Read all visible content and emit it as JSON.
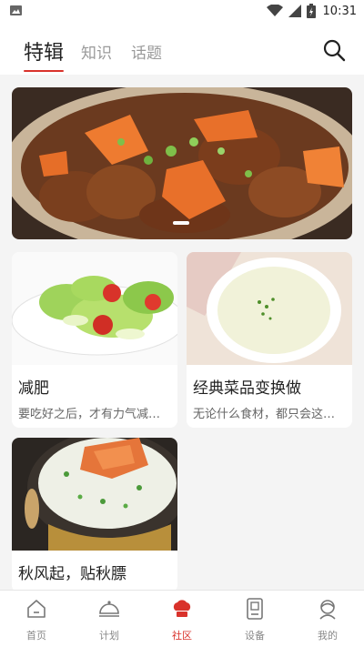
{
  "status_bar": {
    "time": "10:31",
    "icons": [
      "image-notification-icon",
      "wifi-icon",
      "cellular-signal-icon",
      "battery-charging-icon"
    ]
  },
  "header": {
    "tabs": [
      {
        "label": "特辑",
        "active": true
      },
      {
        "label": "知识",
        "active": false
      },
      {
        "label": "话题",
        "active": false
      }
    ],
    "search_icon": "search-icon",
    "accent_color": "#d9322b"
  },
  "banner": {
    "image": "braised-meat-with-carrots-photo",
    "carousel_indicator": "dot"
  },
  "cards": [
    {
      "title": "减肥",
      "desc": "要吃好之后，才有力气减…",
      "image": "vegetable-salad-photo"
    },
    {
      "title": "经典菜品变换做",
      "desc": "无论什么食材，都只会这…",
      "image": "creamy-soup-bowl-photo"
    },
    {
      "title": "秋风起，贴秋膘",
      "desc": "",
      "image": "crab-congee-pot-photo"
    }
  ],
  "bottom_nav": {
    "items": [
      {
        "label": "首页",
        "icon": "home-icon",
        "active": false
      },
      {
        "label": "计划",
        "icon": "cloche-icon",
        "active": false
      },
      {
        "label": "社区",
        "icon": "chef-hat-icon",
        "active": true
      },
      {
        "label": "设备",
        "icon": "device-icon",
        "active": false
      },
      {
        "label": "我的",
        "icon": "profile-icon",
        "active": false
      }
    ]
  }
}
